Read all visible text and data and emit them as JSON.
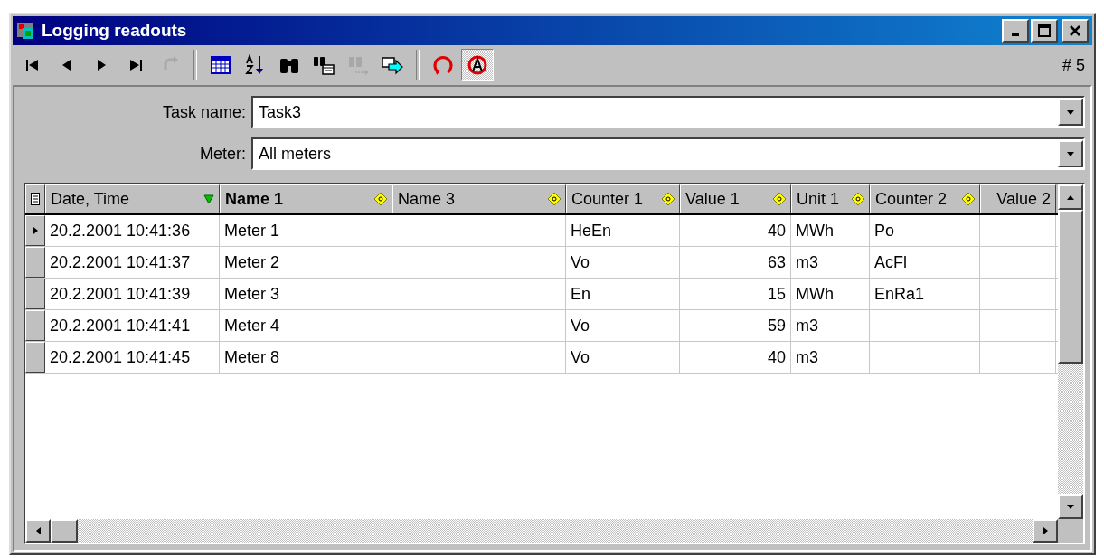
{
  "window": {
    "title": "Logging readouts"
  },
  "toolbar": {
    "buttons": [
      {
        "kind": "first",
        "disabled": false,
        "pressed": false
      },
      {
        "kind": "prev",
        "disabled": false,
        "pressed": false
      },
      {
        "kind": "next",
        "disabled": false,
        "pressed": false
      },
      {
        "kind": "last",
        "disabled": false,
        "pressed": false
      },
      {
        "kind": "refresh",
        "disabled": true,
        "pressed": false
      },
      {
        "kind": "separator"
      },
      {
        "kind": "table",
        "disabled": false,
        "pressed": false
      },
      {
        "kind": "sort",
        "disabled": false,
        "pressed": false
      },
      {
        "kind": "find",
        "disabled": false,
        "pressed": false
      },
      {
        "kind": "find-list",
        "disabled": false,
        "pressed": false
      },
      {
        "kind": "find-next",
        "disabled": true,
        "pressed": false
      },
      {
        "kind": "export",
        "disabled": false,
        "pressed": false
      },
      {
        "kind": "separator"
      },
      {
        "kind": "reload",
        "disabled": false,
        "pressed": false
      },
      {
        "kind": "auto",
        "disabled": false,
        "pressed": true
      }
    ],
    "record_count": "# 5"
  },
  "filters": [
    {
      "label": "Task name:",
      "value": "Task3"
    },
    {
      "label": "Meter:",
      "value": "All meters"
    }
  ],
  "table": {
    "columns": [
      {
        "label": "Date, Time",
        "kind": "text",
        "bold": false,
        "sorted": true,
        "sortable": true
      },
      {
        "label": "Name 1",
        "kind": "text",
        "bold": true,
        "sorted": false,
        "sortable": true
      },
      {
        "label": "Name 3",
        "kind": "text",
        "bold": false,
        "sorted": false,
        "sortable": true
      },
      {
        "label": "Counter 1",
        "kind": "text",
        "bold": false,
        "sorted": false,
        "sortable": true
      },
      {
        "label": "Value 1",
        "kind": "number",
        "bold": false,
        "sorted": false,
        "sortable": true
      },
      {
        "label": "Unit 1",
        "kind": "text",
        "bold": false,
        "sorted": false,
        "sortable": true
      },
      {
        "label": "Counter 2",
        "kind": "text",
        "bold": false,
        "sorted": false,
        "sortable": true
      },
      {
        "label": "Value 2",
        "kind": "number",
        "bold": false,
        "sorted": false,
        "sortable": false
      }
    ],
    "rows": [
      {
        "selected": true,
        "cells": [
          "20.2.2001 10:41:36",
          "Meter 1",
          null,
          "HeEn",
          "40",
          "MWh",
          "Po",
          null
        ]
      },
      {
        "selected": false,
        "cells": [
          "20.2.2001 10:41:37",
          "Meter 2",
          null,
          "Vo",
          "63",
          "m3",
          "AcFl",
          null
        ]
      },
      {
        "selected": false,
        "cells": [
          "20.2.2001 10:41:39",
          "Meter 3",
          null,
          "En",
          "15",
          "MWh",
          "EnRa1",
          null
        ]
      },
      {
        "selected": false,
        "cells": [
          "20.2.2001 10:41:41",
          "Meter 4",
          null,
          "Vo",
          "59",
          "m3",
          null,
          null
        ]
      },
      {
        "selected": false,
        "cells": [
          "20.2.2001 10:41:45",
          "Meter 8",
          null,
          "Vo",
          "40",
          "m3",
          null,
          null
        ]
      }
    ]
  }
}
